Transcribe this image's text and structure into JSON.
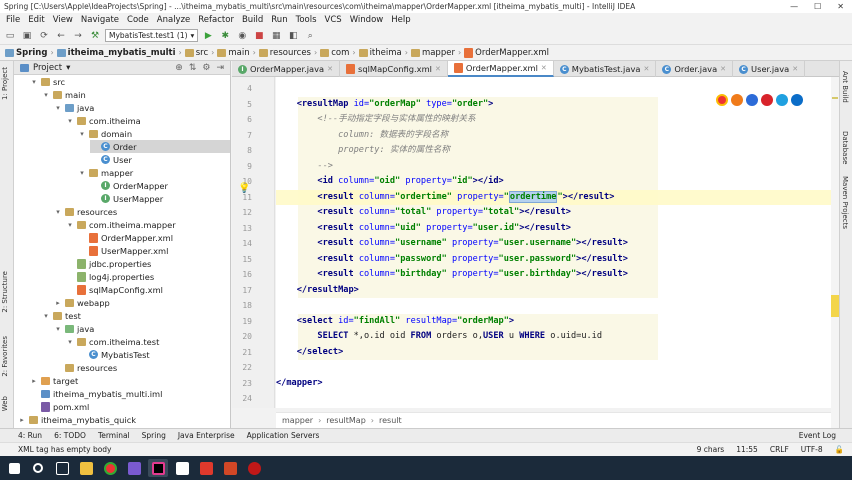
{
  "window": {
    "title": "Spring [C:\\Users\\Apple\\IdeaProjects\\Spring] - ...\\itheima_mybatis_multi\\src\\main\\resources\\com\\itheima\\mapper\\OrderMapper.xml [itheima_mybatis_multi] - IntelliJ IDEA",
    "min": "—",
    "max": "☐",
    "close": "✕"
  },
  "menu": [
    "File",
    "Edit",
    "View",
    "Navigate",
    "Code",
    "Analyze",
    "Refactor",
    "Build",
    "Run",
    "Tools",
    "VCS",
    "Window",
    "Help"
  ],
  "toolbar": {
    "run_config": "MybatisTest.test1 (1)"
  },
  "breadcrumb": [
    "Spring",
    "itheima_mybatis_multi",
    "src",
    "main",
    "resources",
    "com",
    "itheima",
    "mapper",
    "OrderMapper.xml"
  ],
  "project_panel": {
    "title": "Project"
  },
  "tree": [
    {
      "label": "src",
      "level": 2,
      "icon": "folder",
      "arrow": "▾"
    },
    {
      "label": "main",
      "level": 3,
      "icon": "folder",
      "arrow": "▾"
    },
    {
      "label": "java",
      "level": 4,
      "icon": "folder-blue",
      "arrow": "▾"
    },
    {
      "label": "com.itheima",
      "level": 5,
      "icon": "package",
      "arrow": "▾"
    },
    {
      "label": "domain",
      "level": 6,
      "icon": "package",
      "arrow": "▾"
    },
    {
      "label": "Order",
      "level": 7,
      "icon": "class",
      "arrow": "",
      "selected": true
    },
    {
      "label": "User",
      "level": 7,
      "icon": "class",
      "arrow": ""
    },
    {
      "label": "mapper",
      "level": 6,
      "icon": "package",
      "arrow": "▾"
    },
    {
      "label": "OrderMapper",
      "level": 7,
      "icon": "interface",
      "arrow": ""
    },
    {
      "label": "UserMapper",
      "level": 7,
      "icon": "interface",
      "arrow": ""
    },
    {
      "label": "resources",
      "level": 4,
      "icon": "folder",
      "arrow": "▾"
    },
    {
      "label": "com.itheima.mapper",
      "level": 5,
      "icon": "package",
      "arrow": "▾"
    },
    {
      "label": "OrderMapper.xml",
      "level": 6,
      "icon": "xml",
      "arrow": ""
    },
    {
      "label": "UserMapper.xml",
      "level": 6,
      "icon": "xml",
      "arrow": ""
    },
    {
      "label": "jdbc.properties",
      "level": 5,
      "icon": "props",
      "arrow": ""
    },
    {
      "label": "log4j.properties",
      "level": 5,
      "icon": "props",
      "arrow": ""
    },
    {
      "label": "sqlMapConfig.xml",
      "level": 5,
      "icon": "xml",
      "arrow": ""
    },
    {
      "label": "webapp",
      "level": 4,
      "icon": "folder",
      "arrow": "▸"
    },
    {
      "label": "test",
      "level": 3,
      "icon": "folder",
      "arrow": "▾"
    },
    {
      "label": "java",
      "level": 4,
      "icon": "folder-green",
      "arrow": "▾"
    },
    {
      "label": "com.itheima.test",
      "level": 5,
      "icon": "package",
      "arrow": "▾"
    },
    {
      "label": "MybatisTest",
      "level": 6,
      "icon": "class",
      "arrow": ""
    },
    {
      "label": "resources",
      "level": 4,
      "icon": "folder",
      "arrow": ""
    },
    {
      "label": "target",
      "level": 2,
      "icon": "folder-orange",
      "arrow": "▸"
    },
    {
      "label": "itheima_mybatis_multi.iml",
      "level": 2,
      "icon": "module",
      "arrow": ""
    },
    {
      "label": "pom.xml",
      "level": 2,
      "icon": "maven",
      "arrow": ""
    },
    {
      "label": "itheima_mybatis_quick",
      "level": 1,
      "icon": "folder",
      "arrow": "▸"
    }
  ],
  "tabs": [
    {
      "label": "OrderMapper.java",
      "active": false
    },
    {
      "label": "sqlMapConfig.xml",
      "active": false
    },
    {
      "label": "OrderMapper.xml",
      "active": true
    },
    {
      "label": "MybatisTest.java",
      "active": false
    },
    {
      "label": "Order.java",
      "active": false
    },
    {
      "label": "User.java",
      "active": false
    }
  ],
  "code": [
    {
      "n": "4",
      "segs": []
    },
    {
      "n": "5",
      "segs": [
        {
          "t": "    "
        },
        {
          "t": "<resultMap ",
          "c": "tg"
        },
        {
          "t": "id=",
          "c": "at"
        },
        {
          "t": "\"orderMap\"",
          "c": "vl"
        },
        {
          "t": " type=",
          "c": "at"
        },
        {
          "t": "\"order\"",
          "c": "vl"
        },
        {
          "t": ">",
          "c": "tg"
        }
      ]
    },
    {
      "n": "6",
      "segs": [
        {
          "t": "        "
        },
        {
          "t": "<!--手动指定字段与实体属性的映射关系",
          "c": "cm"
        }
      ]
    },
    {
      "n": "7",
      "segs": [
        {
          "t": "            "
        },
        {
          "t": "column: 数据表的字段名称",
          "c": "cm"
        }
      ]
    },
    {
      "n": "8",
      "segs": [
        {
          "t": "            "
        },
        {
          "t": "property: 实体的属性名称",
          "c": "cm"
        }
      ]
    },
    {
      "n": "9",
      "segs": [
        {
          "t": "        "
        },
        {
          "t": "-->",
          "c": "cm"
        }
      ]
    },
    {
      "n": "10",
      "segs": [
        {
          "t": "        "
        },
        {
          "t": "<id ",
          "c": "tg"
        },
        {
          "t": "column=",
          "c": "at"
        },
        {
          "t": "\"oid\"",
          "c": "vl"
        },
        {
          "t": " property=",
          "c": "at"
        },
        {
          "t": "\"id\"",
          "c": "vl"
        },
        {
          "t": "></id>",
          "c": "tg"
        }
      ]
    },
    {
      "n": "11",
      "hl": true,
      "segs": [
        {
          "t": "        "
        },
        {
          "t": "<result ",
          "c": "tg"
        },
        {
          "t": "column=",
          "c": "at"
        },
        {
          "t": "\"ordertime\"",
          "c": "vl"
        },
        {
          "t": " property=",
          "c": "at"
        },
        {
          "t": "\"",
          "c": "vl"
        },
        {
          "t": "ordertime",
          "c": "vl selw"
        },
        {
          "t": "\"",
          "c": "vl"
        },
        {
          "t": "></result>",
          "c": "tg"
        }
      ]
    },
    {
      "n": "12",
      "segs": [
        {
          "t": "        "
        },
        {
          "t": "<result ",
          "c": "tg"
        },
        {
          "t": "column=",
          "c": "at"
        },
        {
          "t": "\"total\"",
          "c": "vl"
        },
        {
          "t": " property=",
          "c": "at"
        },
        {
          "t": "\"total\"",
          "c": "vl"
        },
        {
          "t": "></result>",
          "c": "tg"
        }
      ]
    },
    {
      "n": "13",
      "segs": [
        {
          "t": "        "
        },
        {
          "t": "<result ",
          "c": "tg"
        },
        {
          "t": "column=",
          "c": "at"
        },
        {
          "t": "\"uid\"",
          "c": "vl"
        },
        {
          "t": " property=",
          "c": "at"
        },
        {
          "t": "\"user.id\"",
          "c": "vl"
        },
        {
          "t": "></result>",
          "c": "tg"
        }
      ]
    },
    {
      "n": "14",
      "segs": [
        {
          "t": "        "
        },
        {
          "t": "<result ",
          "c": "tg"
        },
        {
          "t": "column=",
          "c": "at"
        },
        {
          "t": "\"username\"",
          "c": "vl"
        },
        {
          "t": " property=",
          "c": "at"
        },
        {
          "t": "\"user.username\"",
          "c": "vl"
        },
        {
          "t": "></result>",
          "c": "tg"
        }
      ]
    },
    {
      "n": "15",
      "segs": [
        {
          "t": "        "
        },
        {
          "t": "<result ",
          "c": "tg"
        },
        {
          "t": "column=",
          "c": "at"
        },
        {
          "t": "\"password\"",
          "c": "vl"
        },
        {
          "t": " property=",
          "c": "at"
        },
        {
          "t": "\"user.password\"",
          "c": "vl"
        },
        {
          "t": "></result>",
          "c": "tg"
        }
      ]
    },
    {
      "n": "16",
      "segs": [
        {
          "t": "        "
        },
        {
          "t": "<result ",
          "c": "tg"
        },
        {
          "t": "column=",
          "c": "at"
        },
        {
          "t": "\"birthday\"",
          "c": "vl"
        },
        {
          "t": " property=",
          "c": "at"
        },
        {
          "t": "\"user.birthday\"",
          "c": "vl"
        },
        {
          "t": "></result>",
          "c": "tg"
        }
      ]
    },
    {
      "n": "17",
      "segs": [
        {
          "t": "    "
        },
        {
          "t": "</resultMap>",
          "c": "tg"
        }
      ]
    },
    {
      "n": "18",
      "segs": []
    },
    {
      "n": "19",
      "segs": [
        {
          "t": "    "
        },
        {
          "t": "<select ",
          "c": "tg"
        },
        {
          "t": "id=",
          "c": "at"
        },
        {
          "t": "\"findAll\"",
          "c": "vl"
        },
        {
          "t": " resultMap=",
          "c": "at"
        },
        {
          "t": "\"orderMap\"",
          "c": "vl"
        },
        {
          "t": ">",
          "c": "tg"
        }
      ]
    },
    {
      "n": "20",
      "segs": [
        {
          "t": "        "
        },
        {
          "t": "SELECT",
          "c": "kw"
        },
        {
          "t": " *,o.id oid "
        },
        {
          "t": "FROM",
          "c": "kw"
        },
        {
          "t": " orders o,"
        },
        {
          "t": "USER",
          "c": "kw"
        },
        {
          "t": " u "
        },
        {
          "t": "WHERE",
          "c": "kw"
        },
        {
          "t": " o.uid=u.id"
        }
      ]
    },
    {
      "n": "21",
      "segs": [
        {
          "t": "    "
        },
        {
          "t": "</select>",
          "c": "tg"
        }
      ]
    },
    {
      "n": "22",
      "segs": []
    },
    {
      "n": "23",
      "segs": [
        {
          "t": "</mapper>",
          "c": "tg"
        }
      ]
    },
    {
      "n": "24",
      "segs": []
    }
  ],
  "editor_breadcrumb": [
    "mapper",
    "resultMap",
    "result"
  ],
  "left_tool_tabs": [
    "1: Project",
    "2: Structure",
    "2: Favorites",
    "Web"
  ],
  "right_tool_tabs": [
    "Ant Build",
    "Database",
    "Maven Projects"
  ],
  "bottom_tabs": [
    "4: Run",
    "6: TODO",
    "Terminal",
    "Spring",
    "Java Enterprise",
    "Application Servers",
    "Event Log"
  ],
  "status": {
    "message": "XML tag has empty body",
    "chars": "9 chars",
    "position": "11:55",
    "line_sep": "CRLF",
    "encoding": "UTF-8"
  },
  "colors": {
    "accent": "#4a88c7",
    "highlight_line": "#fffbd2",
    "selection": "#b5d1ee"
  }
}
